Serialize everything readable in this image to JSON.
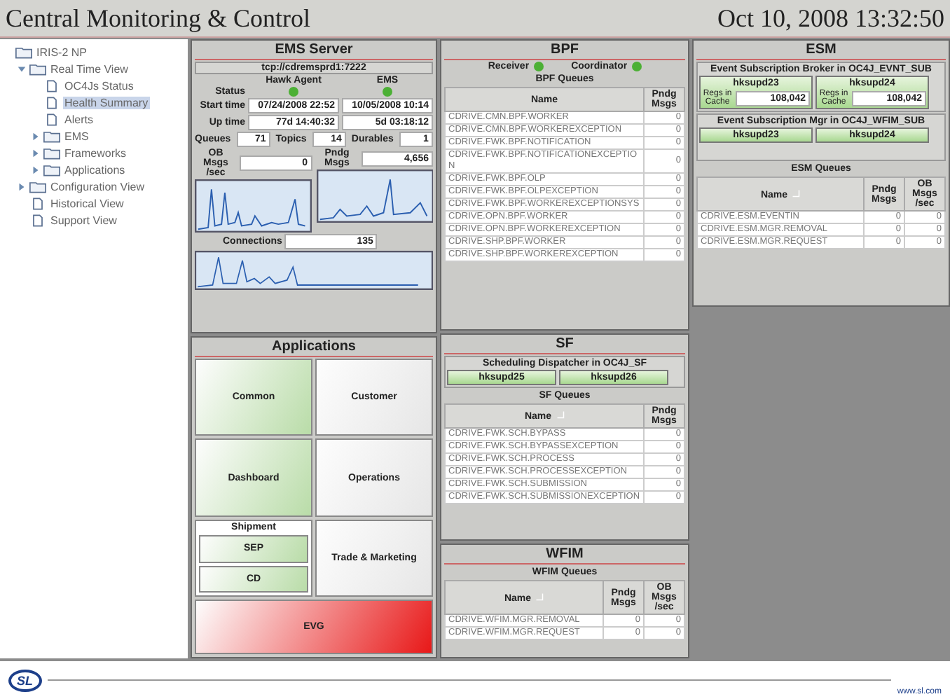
{
  "header": {
    "title": "Central Monitoring & Control",
    "datetime": "Oct 10, 2008 13:32:50"
  },
  "tree": [
    {
      "label": "IRIS-2 NP",
      "kind": "folder",
      "selected": false,
      "children": [
        {
          "label": "Real Time View",
          "kind": "folder",
          "expanded": true,
          "selected": false,
          "children": [
            {
              "label": "OC4Js Status",
              "kind": "page",
              "selected": false
            },
            {
              "label": "Health Summary",
              "kind": "page",
              "selected": true
            },
            {
              "label": "Alerts",
              "kind": "page",
              "selected": false
            },
            {
              "label": "EMS",
              "kind": "folder",
              "expanded": false,
              "selected": false
            },
            {
              "label": "Frameworks",
              "kind": "folder",
              "expanded": false,
              "selected": false
            },
            {
              "label": "Applications",
              "kind": "folder",
              "expanded": false,
              "selected": false
            }
          ]
        },
        {
          "label": "Configuration View",
          "kind": "folder",
          "expanded": false,
          "selected": false
        },
        {
          "label": "Historical View",
          "kind": "page",
          "selected": false
        },
        {
          "label": "Support View",
          "kind": "page",
          "selected": false
        }
      ]
    }
  ],
  "ems": {
    "title": "EMS Server",
    "url": "tcp://cdremsprd1:7222",
    "columns": [
      "Hawk Agent",
      "EMS"
    ],
    "status_label": "Status",
    "status": [
      {
        "color": "#4cb035"
      },
      {
        "color": "#4cb035"
      }
    ],
    "rows": [
      {
        "label": "Start time",
        "values": [
          "07/24/2008 22:52",
          "10/05/2008 10:14"
        ]
      },
      {
        "label": "Up time",
        "values": [
          "77d 14:40:32",
          "5d 03:18:12"
        ]
      }
    ],
    "counts": [
      {
        "label": "Queues",
        "value": "71"
      },
      {
        "label": "Topics",
        "value": "14"
      },
      {
        "label": "Durables",
        "value": "1"
      }
    ],
    "ob": {
      "label": "OB Msgs /sec",
      "value": "0"
    },
    "pndg": {
      "label": "Pndg Msgs",
      "value": "4,656"
    },
    "connections": {
      "label": "Connections",
      "value": "135"
    }
  },
  "apps": {
    "title": "Applications",
    "rows": [
      [
        {
          "kind": "tile",
          "label": "Common",
          "color": "#b9dca8"
        },
        {
          "kind": "tile",
          "label": "Customer",
          "color": "#e6e6e6"
        }
      ],
      [
        {
          "kind": "tile",
          "label": "Dashboard",
          "color": "#b9dca8"
        },
        {
          "kind": "tile",
          "label": "Operations",
          "color": "#e6e6e6"
        }
      ],
      [
        {
          "kind": "group",
          "label": "Shipment",
          "children": [
            {
              "label": "SEP",
              "color": "#b9dca8"
            },
            {
              "label": "CD",
              "color": "#b9dca8"
            }
          ]
        },
        {
          "kind": "tile",
          "label": "Trade & Marketing",
          "color": "#e6e6e6"
        }
      ],
      [
        {
          "kind": "tile",
          "label": "EVG",
          "color": "#e81818"
        }
      ]
    ]
  },
  "bpf": {
    "title": "BPF",
    "indicators": [
      {
        "label": "Receiver",
        "color": "#4cb035"
      },
      {
        "label": "Coordinator",
        "color": "#4cb035"
      }
    ],
    "queues": {
      "title": "BPF Queues",
      "columns": [
        {
          "label": "Name",
          "sorted": false
        },
        {
          "label": "Pndg Msgs",
          "sorted": false
        }
      ],
      "rows": [
        [
          "CDRIVE.CMN.BPF.WORKER",
          "0"
        ],
        [
          "CDRIVE.CMN.BPF.WORKEREXCEPTION",
          "0"
        ],
        [
          "CDRIVE.FWK.BPF.NOTIFICATION",
          "0"
        ],
        [
          "CDRIVE.FWK.BPF.NOTIFICATIONEXCEPTION",
          "0"
        ],
        [
          "CDRIVE.FWK.BPF.OLP",
          "0"
        ],
        [
          "CDRIVE.FWK.BPF.OLPEXCEPTION",
          "0"
        ],
        [
          "CDRIVE.FWK.BPF.WORKEREXCEPTIONSYS",
          "0"
        ],
        [
          "CDRIVE.OPN.BPF.WORKER",
          "0"
        ],
        [
          "CDRIVE.OPN.BPF.WORKEREXCEPTION",
          "0"
        ],
        [
          "CDRIVE.SHP.BPF.WORKER",
          "0"
        ],
        [
          "CDRIVE.SHP.BPF.WORKEREXCEPTION",
          "0"
        ]
      ]
    }
  },
  "sf": {
    "title": "SF",
    "dispatcher": {
      "title": "Scheduling Dispatcher in OC4J_SF",
      "hosts": [
        "hksupd25",
        "hksupd26"
      ]
    },
    "queues": {
      "title": "SF Queues",
      "columns": [
        {
          "label": "Name",
          "sorted": true
        },
        {
          "label": "Pndg Msgs",
          "sorted": false
        }
      ],
      "rows": [
        [
          "CDRIVE.FWK.SCH.BYPASS",
          "0"
        ],
        [
          "CDRIVE.FWK.SCH.BYPASSEXCEPTION",
          "0"
        ],
        [
          "CDRIVE.FWK.SCH.PROCESS",
          "0"
        ],
        [
          "CDRIVE.FWK.SCH.PROCESSEXCEPTION",
          "0"
        ],
        [
          "CDRIVE.FWK.SCH.SUBMISSION",
          "0"
        ],
        [
          "CDRIVE.FWK.SCH.SUBMISSIONEXCEPTION",
          "0"
        ]
      ]
    }
  },
  "wfim": {
    "title": "WFIM",
    "queues": {
      "title": "WFIM Queues",
      "columns": [
        {
          "label": "Name",
          "sorted": true
        },
        {
          "label": "Pndg Msgs",
          "sorted": false
        },
        {
          "label": "OB Msgs /sec",
          "sorted": false
        }
      ],
      "rows": [
        [
          "CDRIVE.WFIM.MGR.REMOVAL",
          "0",
          "0"
        ],
        [
          "CDRIVE.WFIM.MGR.REQUEST",
          "0",
          "0"
        ]
      ]
    }
  },
  "esm": {
    "title": "ESM",
    "broker": {
      "title": "Event Subscription Broker in OC4J_EVNT_SUB",
      "hosts": [
        {
          "name": "hksupd23",
          "cache_label": "Regs in Cache",
          "cache": "108,042"
        },
        {
          "name": "hksupd24",
          "cache_label": "Regs in Cache",
          "cache": "108,042"
        }
      ]
    },
    "mgr": {
      "title": "Event Subscription Mgr in OC4J_WFIM_SUB",
      "hosts": [
        "hksupd23",
        "hksupd24"
      ]
    },
    "queues": {
      "title": "ESM Queues",
      "columns": [
        {
          "label": "Name",
          "sorted": true
        },
        {
          "label": "Pndg Msgs",
          "sorted": false
        },
        {
          "label": "OB Msgs /sec",
          "sorted": false
        }
      ],
      "rows": [
        [
          "CDRIVE.ESM.EVENTIN",
          "0",
          "0"
        ],
        [
          "CDRIVE.ESM.MGR.REMOVAL",
          "0",
          "0"
        ],
        [
          "CDRIVE.ESM.MGR.REQUEST",
          "0",
          "0"
        ]
      ]
    }
  },
  "footer": {
    "logo": "SL",
    "url": "www.sl.com"
  }
}
